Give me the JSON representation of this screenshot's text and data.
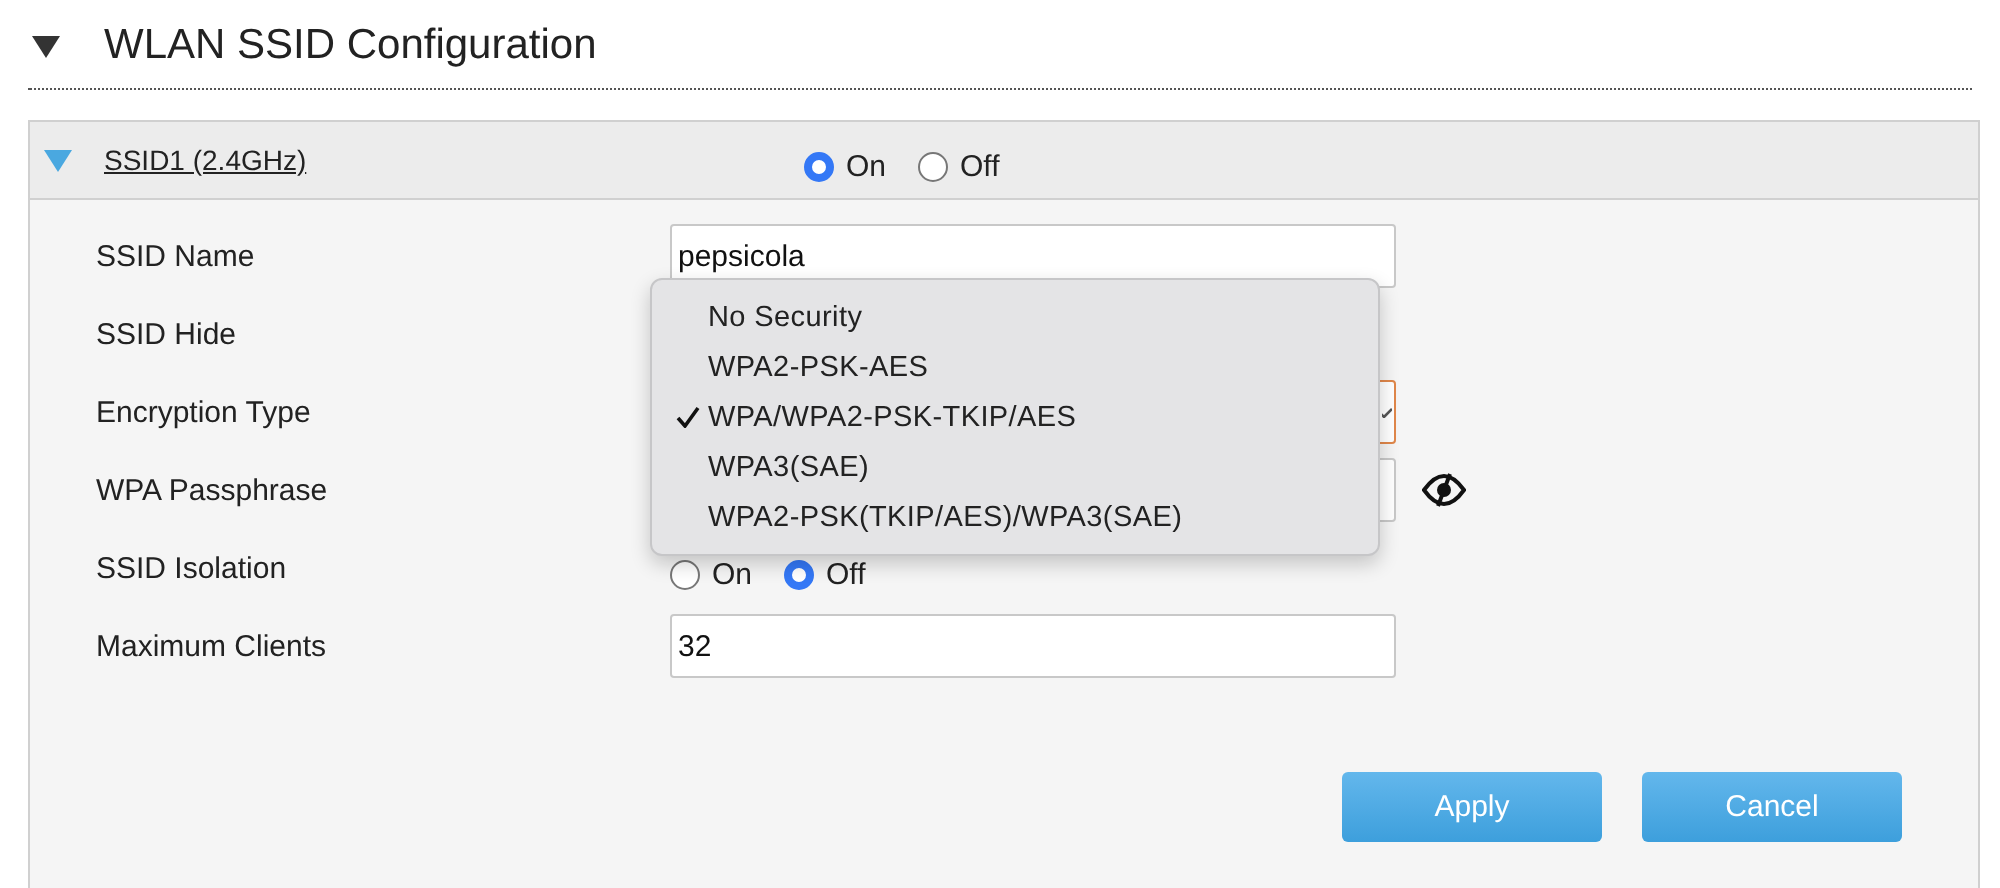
{
  "section": {
    "title": "WLAN SSID Configuration",
    "expanded": true
  },
  "ssid": {
    "title": "SSID1 (2.4GHz)",
    "expanded": true,
    "enable": [
      {
        "label": "On",
        "selected": true
      },
      {
        "label": "Off",
        "selected": false
      }
    ]
  },
  "fields": [
    {
      "kind": "text",
      "label": "SSID Name",
      "value": "pepsicola"
    },
    {
      "kind": "hidden",
      "label": "SSID Hide"
    },
    {
      "kind": "select",
      "label": "Encryption Type"
    },
    {
      "kind": "password",
      "label": "WPA Passphrase"
    },
    {
      "kind": "radio",
      "label": "SSID Isolation",
      "options": [
        {
          "label": "On",
          "selected": false
        },
        {
          "label": "Off",
          "selected": true
        }
      ]
    },
    {
      "kind": "text",
      "label": "Maximum Clients",
      "value": "32"
    }
  ],
  "dropdown": {
    "options": [
      {
        "label": "No Security",
        "selected": false
      },
      {
        "label": "WPA2-PSK-AES",
        "selected": false
      },
      {
        "label": "WPA/WPA2-PSK-TKIP/AES",
        "selected": true
      },
      {
        "label": "WPA3(SAE)",
        "selected": false
      },
      {
        "label": "WPA2-PSK(TKIP/AES)/WPA3(SAE)",
        "selected": false
      }
    ]
  },
  "buttons": [
    {
      "label": "Apply"
    },
    {
      "label": "Cancel"
    }
  ]
}
